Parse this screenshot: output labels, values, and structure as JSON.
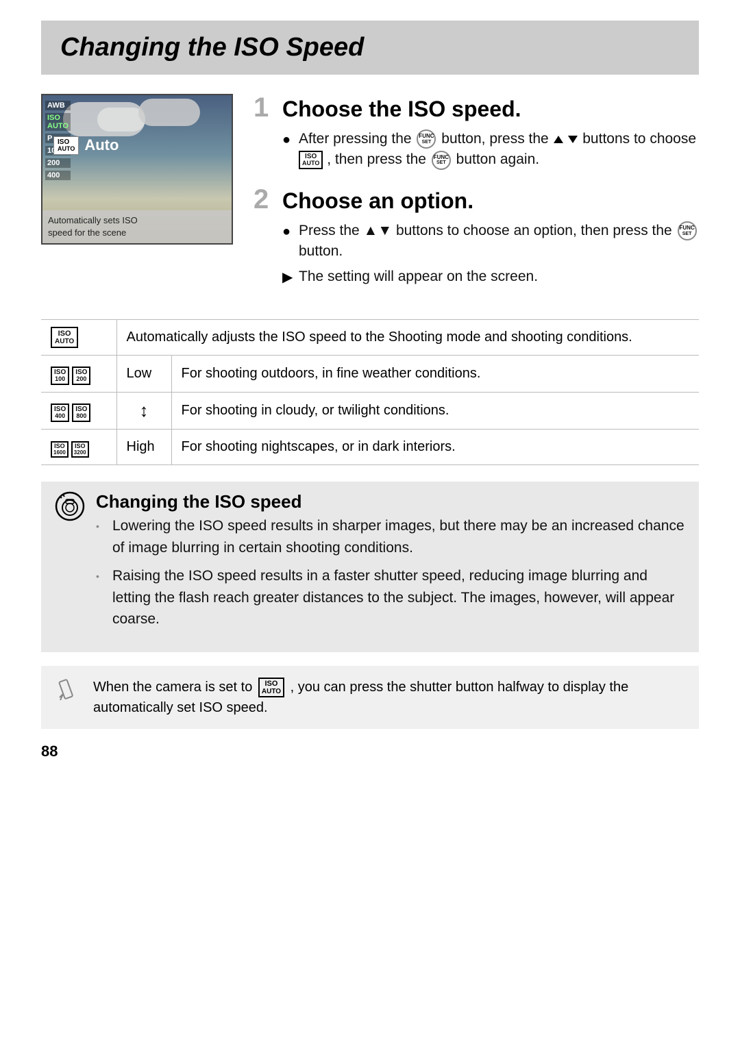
{
  "title": "Changing the ISO Speed",
  "step1": {
    "num": "1",
    "title": "Choose the ISO speed.",
    "bullet1_pre": "After pressing the",
    "bullet1_mid": "button, press the",
    "bullet1_updown": "▲▼",
    "bullet1_post": "buttons to choose",
    "bullet1_end": ", then press the",
    "bullet1_final": "button again."
  },
  "step2": {
    "num": "2",
    "title": "Choose an option.",
    "bullet1_pre": "Press the ▲▼ buttons to choose an option, then press the",
    "bullet1_end": "button.",
    "bullet2": "The setting will appear on the screen."
  },
  "camera": {
    "labels": [
      "AWB",
      "ISO AUTO",
      "P",
      "100",
      "200",
      "400"
    ],
    "auto_text": "Auto",
    "desc_line1": "Automatically sets ISO",
    "desc_line2": "speed for the scene"
  },
  "table": {
    "rows": [
      {
        "icon_label": "ISO AUTO",
        "label": "",
        "desc": "Automatically adjusts the ISO speed to the Shooting mode and shooting conditions."
      },
      {
        "icon_label": "ISO 100 / ISO 200",
        "label": "Low",
        "desc": "For shooting outdoors, in fine weather conditions."
      },
      {
        "icon_label": "ISO 400 / ISO 800",
        "label": "↕",
        "desc": "For shooting in cloudy, or twilight conditions."
      },
      {
        "icon_label": "ISO 1600 / ISO 3200",
        "label": "High",
        "desc": "For shooting nightscapes, or in dark interiors."
      }
    ]
  },
  "tip": {
    "title": "Changing the ISO speed",
    "bullets": [
      "Lowering the ISO speed results in sharper images, but there may be an increased chance of image blurring in certain shooting conditions.",
      "Raising the ISO speed results in a faster shutter speed, reducing image blurring and letting the flash reach greater distances to the subject. The images, however, will appear coarse."
    ]
  },
  "note": {
    "text_pre": "When the camera is set to",
    "text_mid": ", you can press the shutter button halfway to display the automatically set ISO speed."
  },
  "page_number": "88"
}
